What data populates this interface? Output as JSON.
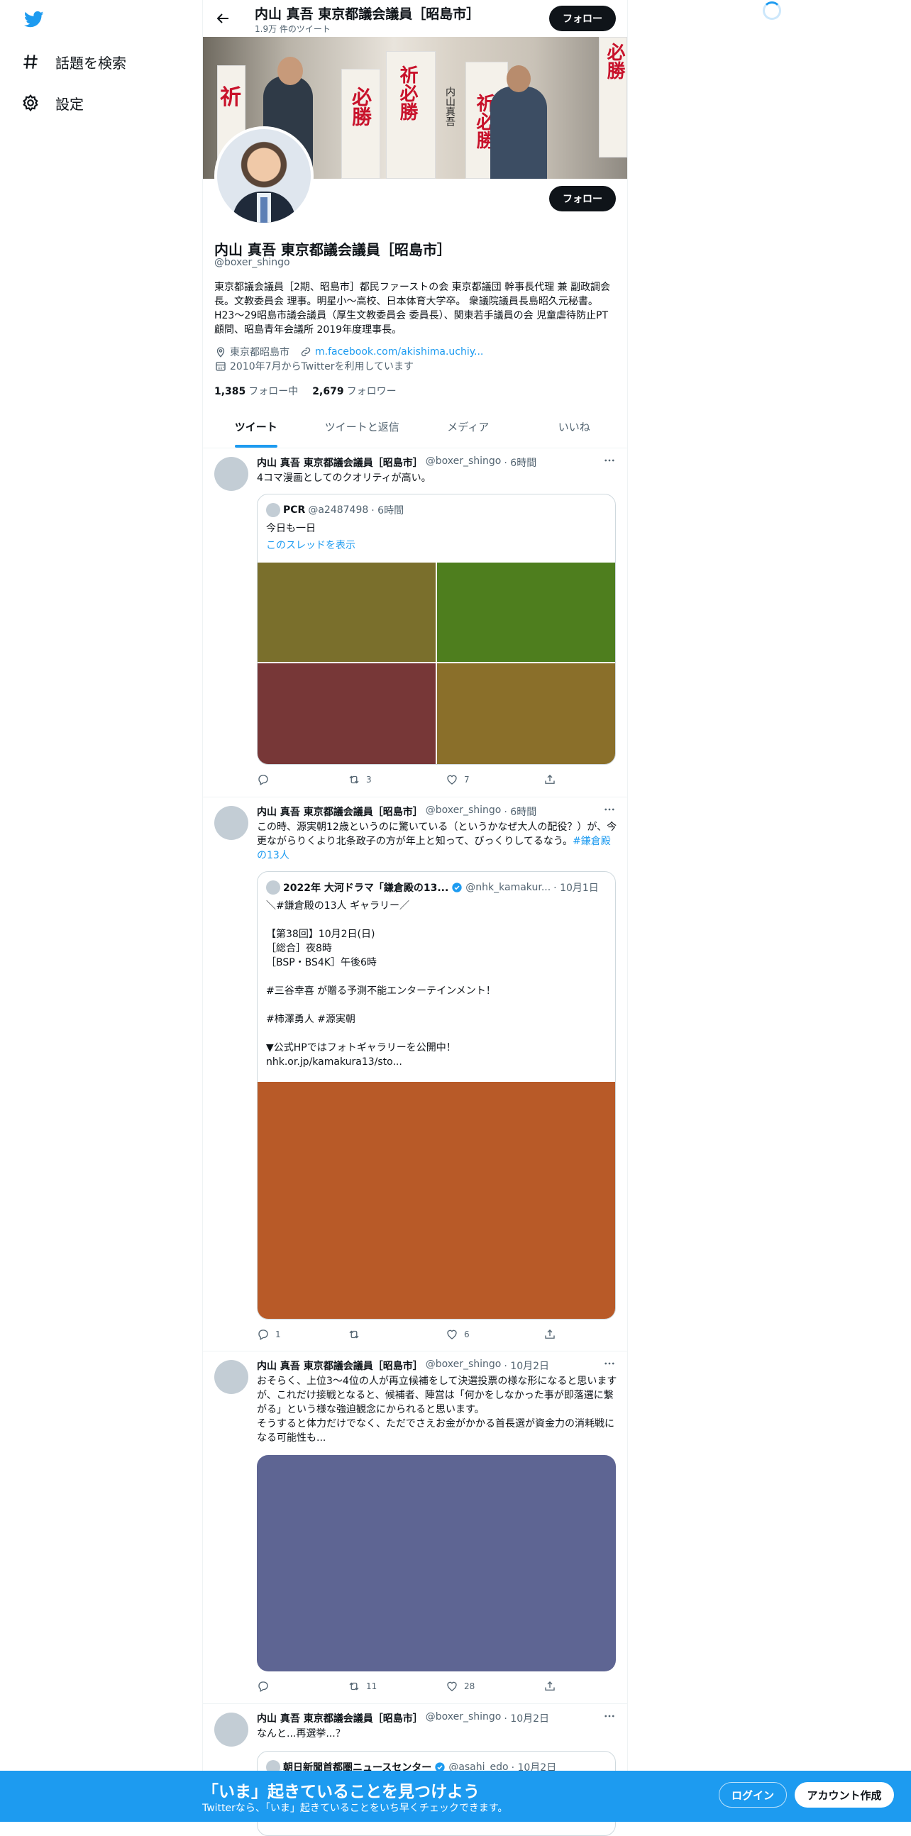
{
  "nav": {
    "items": [
      {
        "label": "話題を検索",
        "icon": "hashtag-icon"
      },
      {
        "label": "設定",
        "icon": "gear-icon"
      }
    ]
  },
  "header": {
    "name": "内山 真吾 東京都議会議員［昭島市］",
    "tweet_count": "1.9万 件のツイート",
    "follow_label": "フォロー"
  },
  "banner": {
    "text_1": "祈",
    "text_2": "必勝",
    "text_3": "祈必勝",
    "text_4": "内山真吾",
    "text_5": "祈必勝",
    "text_6": "必勝"
  },
  "profile": {
    "name": "内山 真吾 東京都議会議員［昭島市］",
    "handle": "@boxer_shingo",
    "follow_label": "フォロー",
    "bio": "東京都議会議員［2期、昭島市］都民ファーストの会 東京都議団 幹事長代理 兼 副政調会長。文教委員会 理事。明星小〜高校、日本体育大学卒。 衆議院議員長島昭久元秘書。H23〜29昭島市議会議員（厚生文教委員会 委員長）、関東若手議員の会 児童虐待防止PT 顧問、昭島青年会議所 2019年度理事長。",
    "location": "東京都昭島市",
    "url": "m.facebook.com/akishima.uchiy...",
    "joined": "2010年7月からTwitterを利用しています",
    "following_count": "1,385",
    "following_label": "フォロー中",
    "followers_count": "2,679",
    "followers_label": "フォロワー"
  },
  "tabs": [
    "ツイート",
    "ツイートと返信",
    "メディア",
    "いいね"
  ],
  "tweets": [
    {
      "name": "内山 真吾 東京都議会議員［昭島市］",
      "handle": "@boxer_shingo",
      "time": "· 6時間",
      "text": "4コマ漫画としてのクオリティが高い。",
      "quote": {
        "name": "PCR",
        "handle": "@a2487498",
        "time": "· 6時間",
        "text": "今日も一日",
        "thread_link": "このスレッドを表示"
      },
      "media_colors": [
        "#7a6f2c",
        "#4e7e1e",
        "#773737",
        "#8a6f2a"
      ],
      "replies": "",
      "retweets": "3",
      "likes": "7"
    },
    {
      "name": "内山 真吾 東京都議会議員［昭島市］",
      "handle": "@boxer_shingo",
      "time": "· 6時間",
      "text": "この時、源実朝12歳というのに驚いている（というかなぜ大人の配役？）が、今更ながらりくより北条政子の方が年上と知って、びっくりしてるなう。",
      "hashtag": "#鎌倉殿の13人",
      "quote": {
        "name": "2022年 大河ドラマ「鎌倉殿の13...",
        "handle": "@nhk_kamakur...",
        "time": "· 10月1日",
        "text": "＼#鎌倉殿の13人 ギャラリー／\n\n【第38回】10月2日(日)\n［総合］夜8時\n［BSP・BS4K］午後6時\n\n#三谷幸喜 が贈る予測不能エンターテインメント！\n\n#柿澤勇人 #源実朝\n\n▼公式HPではフォトギャラリーを公開中！\nnhk.or.jp/kamakura13/sto..."
      },
      "media_color": "#b85a28",
      "replies": "1",
      "retweets": "",
      "likes": "6"
    },
    {
      "name": "内山 真吾 東京都議会議員［昭島市］",
      "handle": "@boxer_shingo",
      "time": "· 10月2日",
      "text": "おそらく、上位3〜4位の人が再立候補をして決選投票の様な形になると思いますが、これだけ接戦となると、候補者、陣営は「何かをしなかった事が即落選に繋がる」という様な強迫観念にかられると思います。\nそうすると体力だけでなく、ただでさえお金がかかる首長選が資金力の消耗戦になる可能性も...",
      "media_color": "#5e6593",
      "replies": "",
      "retweets": "11",
      "likes": "28"
    },
    {
      "name": "内山 真吾 東京都議会議員［昭島市］",
      "handle": "@boxer_shingo",
      "time": "· 10月2日",
      "text": "なんと...再選挙...？",
      "quote": {
        "name": "朝日新聞首都圏ニュースセンター",
        "handle": "@asahi_edo",
        "time": "· 10月2日"
      }
    }
  ],
  "bottom_bar": {
    "title": "「いま」起きていることを見つけよう",
    "subtitle": "Twitterなら、「いま」起きていることをいち早くチェックできます。",
    "login_label": "ログイン",
    "signup_label": "アカウント作成"
  },
  "colors": {
    "accent": "#1d9bf0",
    "text": "#0f1419",
    "secondary": "#536471"
  }
}
